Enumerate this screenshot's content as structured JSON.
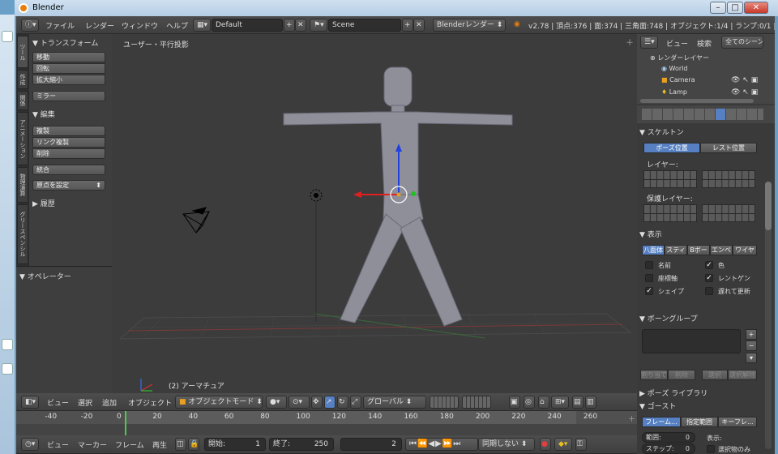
{
  "window": {
    "title": "Blender",
    "minimize": "–",
    "maximize": "□",
    "close": "✕"
  },
  "infobar": {
    "menus": [
      "ファイル",
      "レンダー",
      "ウィンドウ",
      "ヘルプ"
    ],
    "layout": "Default",
    "scene": "Scene",
    "engine": "Blenderレンダー",
    "stats": "v2.78 | 頂点:376 | 面:374 | 三角面:748 | オブジェクト:1/4 | ランプ:0/1 | メモリ:2"
  },
  "viewport": {
    "view_label": "ユーザー・平行投影",
    "object_label": "(2) アーマチュア"
  },
  "vertical_tabs": [
    "ツール",
    "作成",
    "関係",
    "アニメーション",
    "物理演算",
    "グリースペンシル"
  ],
  "toolshelf": {
    "transform_header": "▼ トランスフォーム",
    "transform": [
      "移動",
      "回転",
      "拡大縮小"
    ],
    "mirror": "ミラー",
    "edit_header": "▼ 編集",
    "edit": [
      "複製",
      "リンク複製",
      "削除"
    ],
    "join": "統合",
    "origin": "原点を設定",
    "history": "▶ 履歴",
    "operator": "▼ オペレーター"
  },
  "view3d_header": {
    "menus": [
      "ビュー",
      "選択",
      "追加",
      "オブジェクト"
    ],
    "mode": "オブジェクトモード",
    "orientation": "グローバル"
  },
  "timeline": {
    "ticks": [
      "-40",
      "-20",
      "0",
      "20",
      "40",
      "60",
      "80",
      "100",
      "120",
      "140",
      "160",
      "180",
      "200",
      "220",
      "240",
      "260"
    ]
  },
  "timeline_header": {
    "menus": [
      "ビュー",
      "マーカー",
      "フレーム",
      "再生"
    ],
    "start_label": "開始:",
    "start": "1",
    "end_label": "終了:",
    "end": "250",
    "current": "2",
    "sync": "同期しない"
  },
  "outliner": {
    "menus": [
      "ビュー",
      "検索"
    ],
    "filter": "全てのシーン",
    "items": [
      "レンダーレイヤー",
      "World",
      "Camera",
      "Lamp"
    ]
  },
  "properties": {
    "skeleton_header": "▼ スケルトン",
    "pose_position": "ポーズ位置",
    "rest_position": "レスト位置",
    "layers_label": "レイヤー:",
    "protected_label": "保護レイヤー:",
    "display_header": "▼ 表示",
    "display_types": [
      "八面体",
      "スティ",
      "Bボー",
      "エンベ",
      "ワイヤ"
    ],
    "checks": [
      {
        "label": "名前",
        "checked": false
      },
      {
        "label": "色",
        "checked": true
      },
      {
        "label": "座標軸",
        "checked": false
      },
      {
        "label": "レントゲン",
        "checked": true
      },
      {
        "label": "シェイプ",
        "checked": true
      },
      {
        "label": "遅れて更新",
        "checked": false
      }
    ],
    "bonegroup_header": "▼ ボーングループ",
    "bonegroup_buttons": [
      "割り当て",
      "削除",
      "選択",
      "選択解除"
    ],
    "pose_library": "▶ ポーズ ライブラリ",
    "ghost_header": "▼ ゴースト",
    "ghost_types": [
      "フレーム...",
      "指定範囲",
      "キーフレ..."
    ],
    "range_label": "範囲:",
    "range": "0",
    "step_label": "ステップ:",
    "step": "0",
    "display_label": "表示:",
    "selected_only": "選択物のみ"
  },
  "colors": {
    "accent": "#5680c2",
    "bg": "#393939",
    "viewport": "#3c3c3c"
  }
}
